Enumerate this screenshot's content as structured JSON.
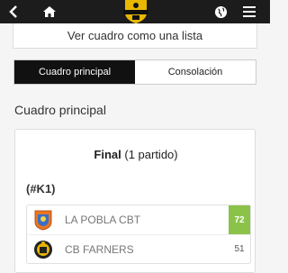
{
  "nav": {
    "back_icon": "chevron-left-icon",
    "home_icon": "home-icon",
    "logo_icon": "club-logo-icon",
    "globe_icon": "globe-icon",
    "menu_icon": "hamburger-menu-icon"
  },
  "list_link": {
    "label": "Ver cuadro como una lista"
  },
  "tabs": [
    {
      "label": "Cuadro principal",
      "active": true
    },
    {
      "label": "Consolación",
      "active": false
    }
  ],
  "section": {
    "title": "Cuadro principal"
  },
  "round": {
    "name": "Final",
    "count": "(1 partido)"
  },
  "match": {
    "code": "(#K1)",
    "teams": [
      {
        "name": "LA POBLA CBT",
        "score": "72",
        "winner": true
      },
      {
        "name": "CB FARNERS",
        "score": "51",
        "winner": false
      }
    ]
  },
  "colors": {
    "topbar": "#1c1c1c",
    "winner": "#8bc34a",
    "active_tab": "#111111"
  }
}
